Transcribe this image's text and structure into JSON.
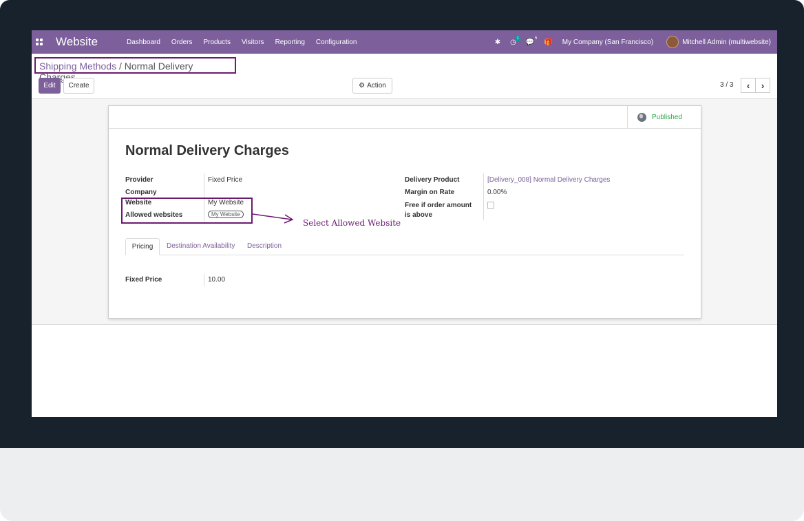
{
  "navbar": {
    "app_name": "Website",
    "menu": [
      "Dashboard",
      "Orders",
      "Products",
      "Visitors",
      "Reporting",
      "Configuration"
    ],
    "activity_badge": "1",
    "messages_badge": "5",
    "company": "My Company (San Francisco)",
    "user": "Mitchell Admin (multiwebsite)"
  },
  "breadcrumb": {
    "parent": "Shipping Methods",
    "separator": "/",
    "current": "Normal Delivery Charges"
  },
  "toolbar": {
    "edit_label": "Edit",
    "create_label": "Create",
    "action_label": "Action",
    "pager": "3 / 3"
  },
  "form": {
    "status": "Published",
    "title": "Normal Delivery Charges",
    "left_fields": {
      "provider_label": "Provider",
      "provider_value": "Fixed Price",
      "company_label": "Company",
      "website_label": "Website",
      "website_value": "My Website",
      "allowed_label": "Allowed websites",
      "allowed_value": "My Website"
    },
    "right_fields": {
      "product_label": "Delivery Product",
      "product_value": "[Delivery_008] Normal Delivery Charges",
      "margin_label": "Margin on Rate",
      "margin_value": "0.00%",
      "free_label_1": "Free if order amount",
      "free_label_2": "is above"
    },
    "tabs": [
      "Pricing",
      "Destination Availability",
      "Description"
    ],
    "fixed_price_label": "Fixed Price",
    "fixed_price_value": "10.00"
  },
  "annotation": {
    "text": "Select Allowed Website",
    "color": "#6b1a6f"
  },
  "colors": {
    "brand": "#7c5f9b",
    "published": "#28a745",
    "frame": "#17222d"
  }
}
